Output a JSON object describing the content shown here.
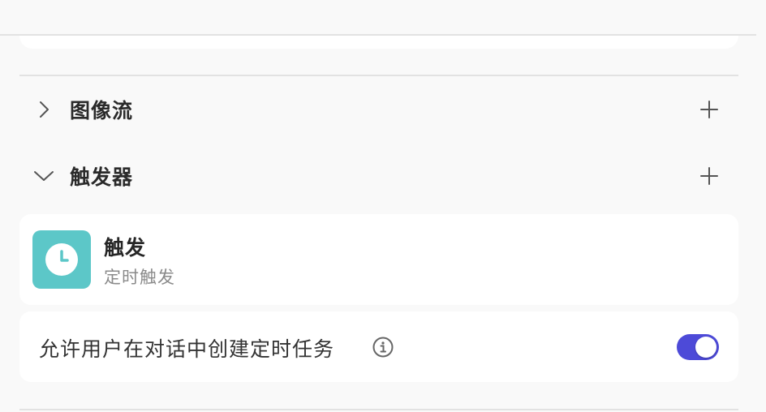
{
  "sections": {
    "image_flow": {
      "title": "图像流",
      "expanded": false,
      "icon": "chevron-right-icon",
      "action_icon": "plus-icon"
    },
    "triggers": {
      "title": "触发器",
      "expanded": true,
      "icon": "chevron-down-icon",
      "action_icon": "plus-icon"
    }
  },
  "trigger_item": {
    "name": "触发",
    "description": "定时触发",
    "icon": "clock-icon",
    "icon_bg": "#5cc7c8"
  },
  "setting": {
    "label": "允许用户在对话中创建定时任务",
    "info_icon": "info-icon",
    "toggle_on": true,
    "toggle_color": "#4d4ad8"
  }
}
